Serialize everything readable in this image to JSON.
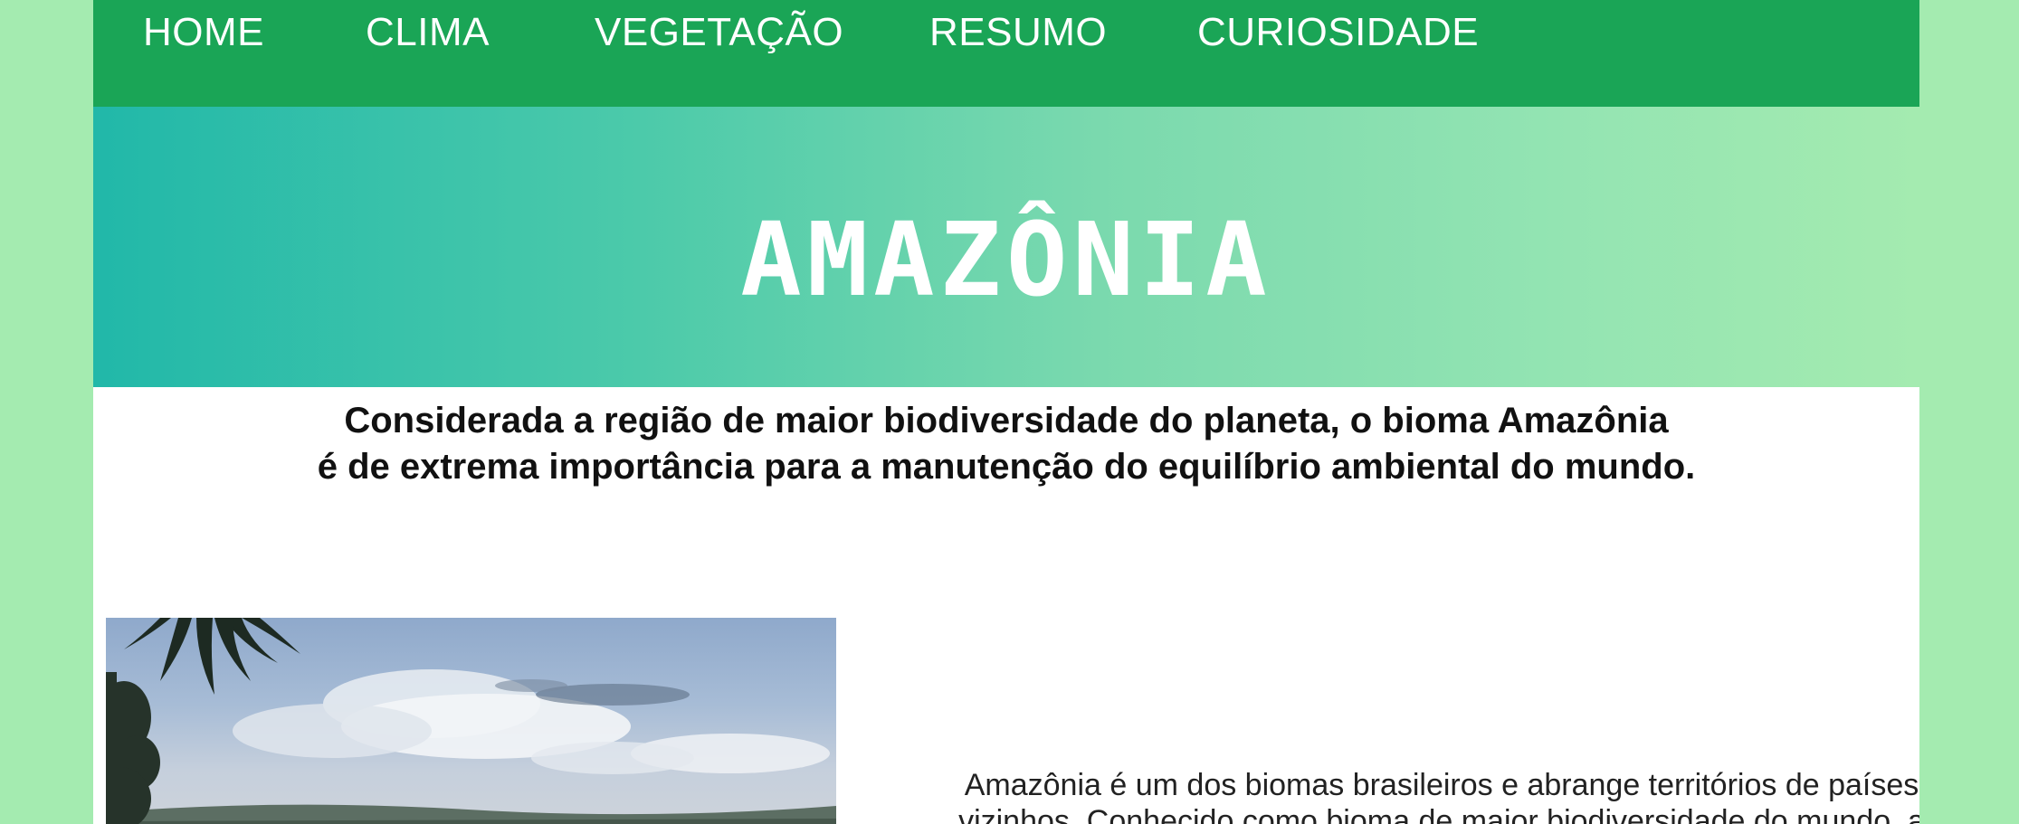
{
  "nav": {
    "items": [
      {
        "label": "HOME"
      },
      {
        "label": "CLIMA"
      },
      {
        "label": "VEGETAÇÃO"
      },
      {
        "label": "RESUMO"
      },
      {
        "label": "CURIOSIDADE"
      }
    ]
  },
  "hero": {
    "title": "AMAZÔNIA"
  },
  "intro": {
    "line1": "Considerada a região de maior biodiversidade do planeta, o bioma Amazônia",
    "line2": "é de extrema importância para a manutenção do equilíbrio ambiental do mundo."
  },
  "article": {
    "line1": "Amazônia é um dos biomas brasileiros e abrange territórios de países",
    "line2": "vizinhos. Conhecido como bioma de maior biodiversidade do mundo, a"
  },
  "colors": {
    "page_background": "#a4ebb0",
    "navbar": "#1aa556",
    "hero_gradient_start": "#21b8a9",
    "hero_gradient_end": "#a4ebb0"
  }
}
